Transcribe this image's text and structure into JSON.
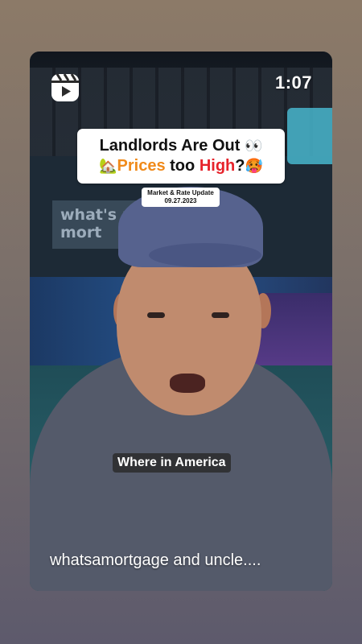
{
  "reel": {
    "duration": "1:07",
    "title_line1": "Landlords Are Out",
    "title_line1_emoji": "👀",
    "title_line2_house_emoji": "🏡",
    "title_line2_prices": "Prices",
    "title_line2_too": " too ",
    "title_line2_high": "High",
    "title_line2_q": "?",
    "title_line2_emoji": "🥵",
    "tag_line1": "Market & Rate Update",
    "tag_line2": "09.27.2023",
    "caption": "Where in America",
    "description": "whatsamortgage and uncle...."
  },
  "background": {
    "wall_text_line1": "what's a",
    "wall_text_line2": "mort"
  },
  "colors": {
    "page_gradient_top": "#8c7a68",
    "page_gradient_bottom": "#5d5a6c",
    "title_orange": "#f08a1a",
    "title_red": "#e6232b"
  },
  "icons": {
    "reels": "reels-icon"
  }
}
